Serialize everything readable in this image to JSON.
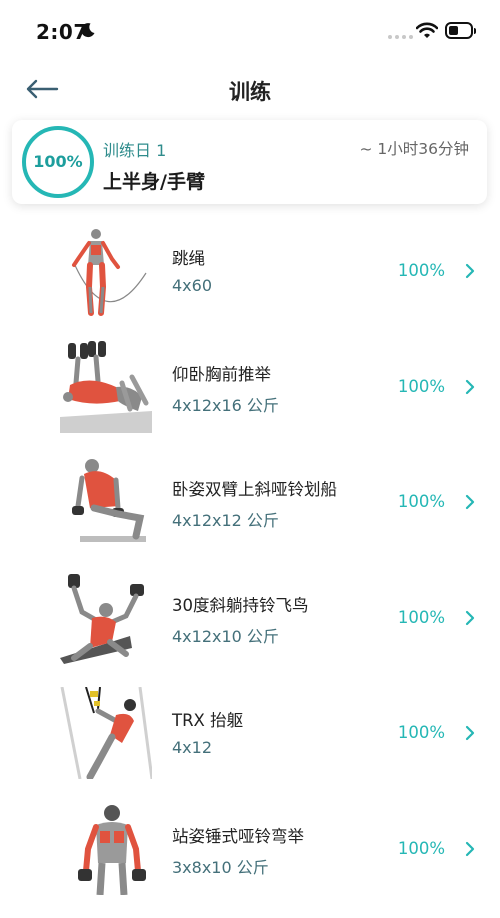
{
  "status_bar": {
    "time": "2:07"
  },
  "nav": {
    "title": "训练"
  },
  "day_card": {
    "progress": "100%",
    "day_label": "训练日 1",
    "duration": "~ 1小时36分钟",
    "name": "上半身/手臂"
  },
  "colors": {
    "accent": "#25b7b5",
    "muscle": "#e0533f"
  },
  "exercises": [
    {
      "name": "跳绳",
      "sets": "4x60",
      "progress": "100%",
      "icon": "jump-rope-figure"
    },
    {
      "name": "仰卧胸前推举",
      "sets": "4x12x16 公斤",
      "progress": "100%",
      "icon": "chest-press-figure"
    },
    {
      "name": "卧姿双臂上斜哑铃划船",
      "sets": "4x12x12 公斤",
      "progress": "100%",
      "icon": "incline-row-figure"
    },
    {
      "name": "30度斜躺持铃飞鸟",
      "sets": "4x12x10 公斤",
      "progress": "100%",
      "icon": "incline-fly-figure"
    },
    {
      "name": "TRX 抬躯",
      "sets": "4x12",
      "progress": "100%",
      "icon": "trx-row-figure"
    },
    {
      "name": "站姿锤式哑铃弯举",
      "sets": "3x8x10 公斤",
      "progress": "100%",
      "icon": "hammer-curl-figure"
    }
  ]
}
